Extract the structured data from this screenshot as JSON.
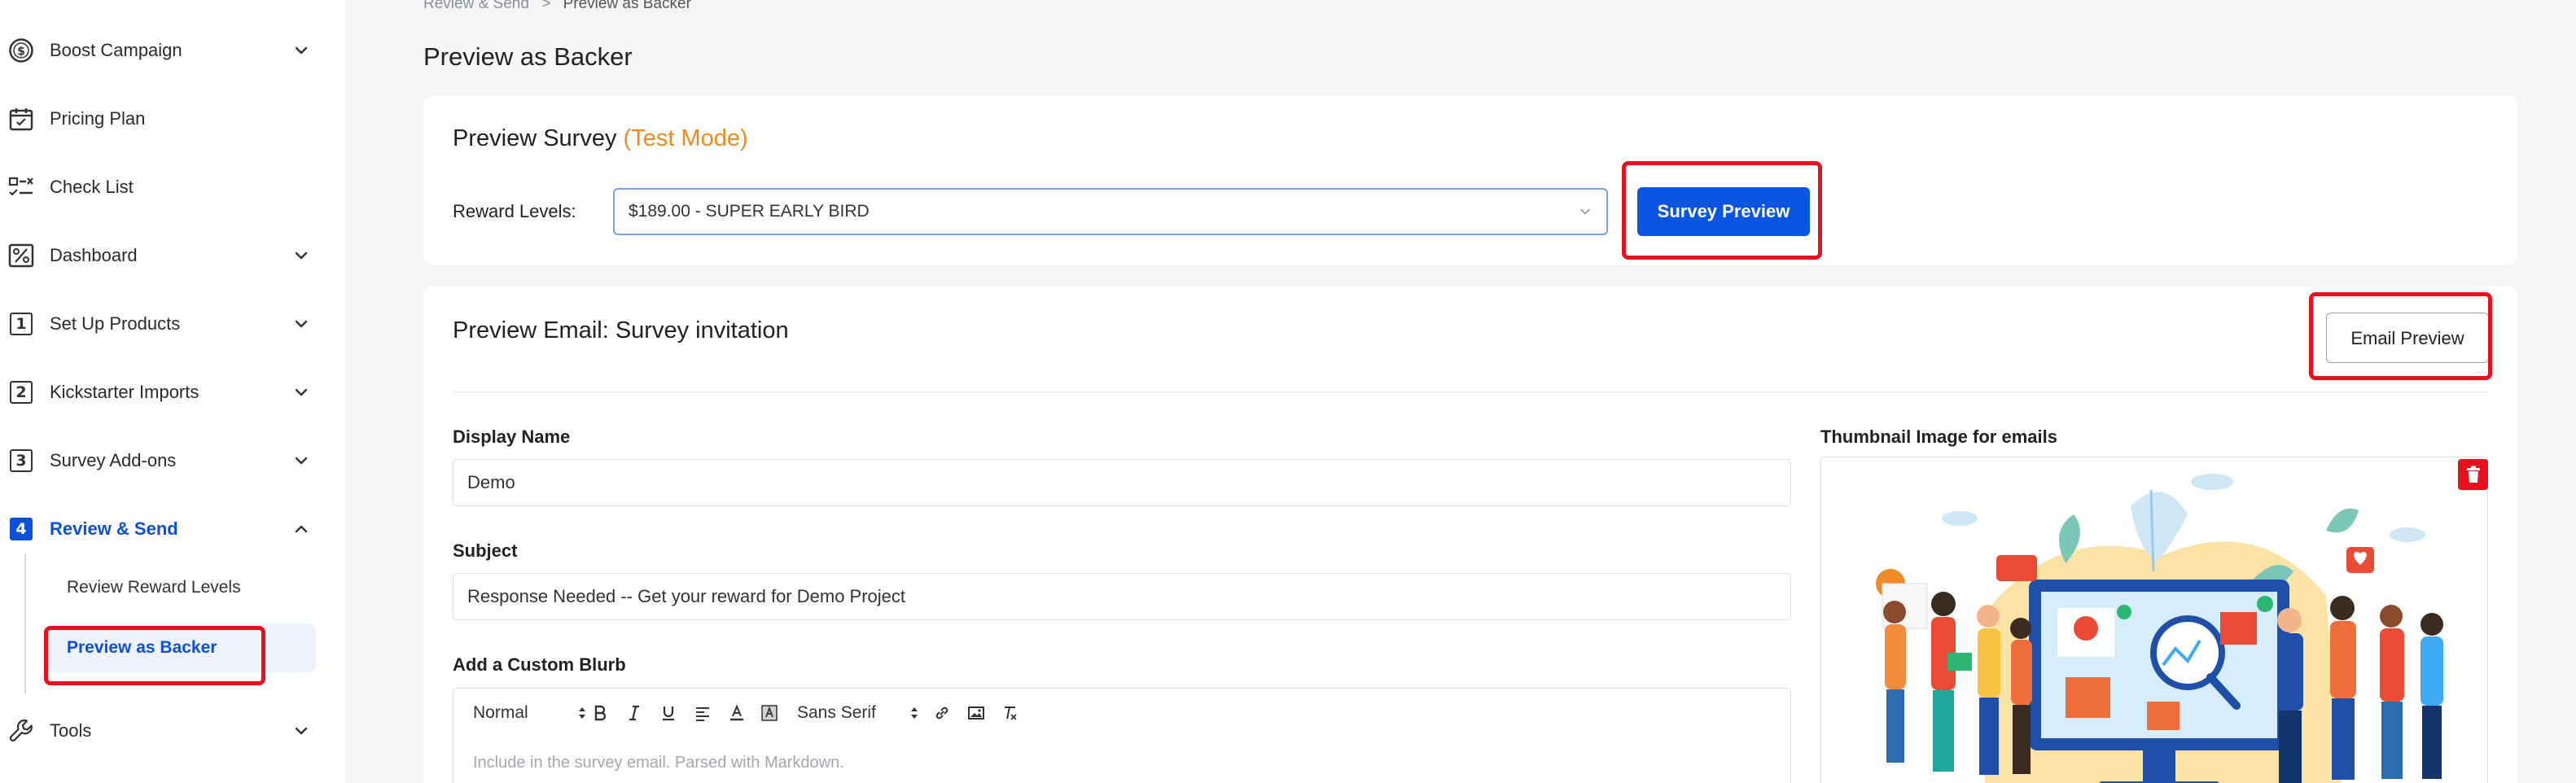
{
  "sidebar": {
    "items": [
      {
        "label": "Boost Campaign",
        "icon": "dollar-coin-icon",
        "has_chevron": true
      },
      {
        "label": "Pricing Plan",
        "icon": "calendar-icon",
        "has_chevron": false
      },
      {
        "label": "Check List",
        "icon": "checklist-icon",
        "has_chevron": false
      },
      {
        "label": "Dashboard",
        "icon": "percent-icon",
        "has_chevron": true
      },
      {
        "label": "Set Up Products",
        "icon": "step-1-icon",
        "step": "1",
        "has_chevron": true
      },
      {
        "label": "Kickstarter Imports",
        "icon": "step-2-icon",
        "step": "2",
        "has_chevron": true
      },
      {
        "label": "Survey Add-ons",
        "icon": "step-3-icon",
        "step": "3",
        "has_chevron": true
      },
      {
        "label": "Review & Send",
        "icon": "step-4-icon",
        "step": "4",
        "has_chevron": true,
        "expanded": true,
        "active": true
      },
      {
        "label": "Tools",
        "icon": "wrench-icon",
        "has_chevron": true
      }
    ],
    "sub_items": [
      {
        "label": "Review Reward Levels",
        "active": false
      },
      {
        "label": "Preview as Backer",
        "active": true
      }
    ]
  },
  "breadcrumb": {
    "parent": "Review & Send",
    "separator": ">",
    "current": "Preview as Backer"
  },
  "page": {
    "title": "Preview as Backer"
  },
  "survey_card": {
    "title": "Preview Survey",
    "mode": "(Test Mode)",
    "reward_label": "Reward Levels:",
    "reward_selected": "$189.00 - SUPER EARLY BIRD",
    "preview_button": "Survey Preview"
  },
  "email_card": {
    "title": "Preview Email: Survey invitation",
    "preview_button": "Email Preview",
    "display_name_label": "Display Name",
    "display_name_value": "Demo",
    "subject_label": "Subject",
    "subject_value": "Response Needed -- Get your reward for Demo Project",
    "blurb_label": "Add a Custom Blurb",
    "blurb_placeholder": "Include in the survey email. Parsed with Markdown.",
    "thumbnail_label": "Thumbnail Image for emails",
    "toolbar": {
      "format": "Normal",
      "font": "Sans Serif"
    }
  },
  "colors": {
    "accent": "#0a56e0",
    "active_text": "#0d4fd6",
    "test_mode": "#f08a1d",
    "highlight": "#e8101c"
  }
}
